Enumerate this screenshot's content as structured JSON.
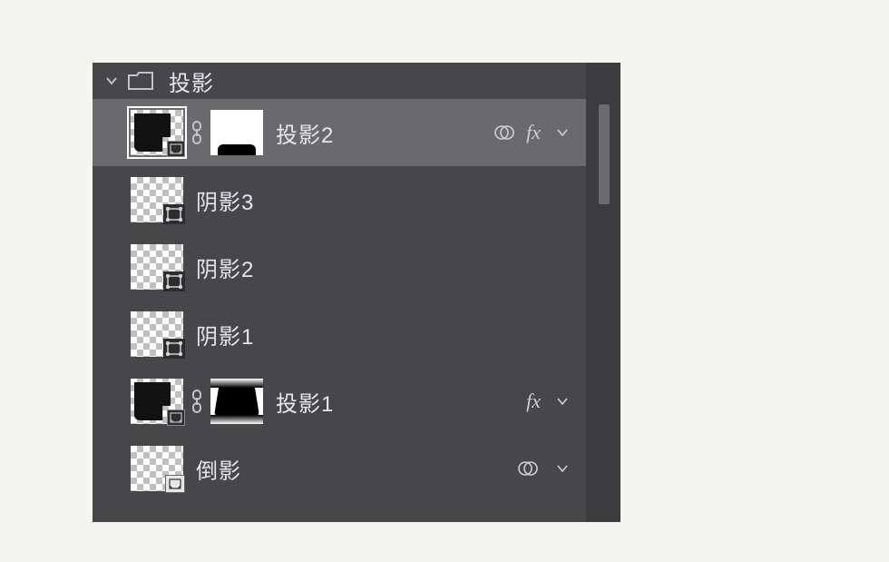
{
  "group": {
    "name": "投影",
    "expanded": true
  },
  "layers": [
    {
      "id": "proj2",
      "name": "投影2",
      "selected": true,
      "has_mask": true,
      "linked": true,
      "mask_kind": "white-blob",
      "thumb_kind": "black-c-checker",
      "smart": true,
      "blend_icon": true,
      "fx": true,
      "chevron": true
    },
    {
      "id": "shadow3",
      "name": "阴影3",
      "selected": false,
      "has_mask": false,
      "linked": false,
      "thumb_kind": "checker-shape",
      "smart": false
    },
    {
      "id": "shadow2",
      "name": "阴影2",
      "selected": false,
      "has_mask": false,
      "linked": false,
      "thumb_kind": "checker-shape",
      "smart": false
    },
    {
      "id": "shadow1",
      "name": "阴影1",
      "selected": false,
      "has_mask": false,
      "linked": false,
      "thumb_kind": "checker-shape",
      "smart": false
    },
    {
      "id": "proj1",
      "name": "投影1",
      "selected": false,
      "has_mask": true,
      "linked": true,
      "mask_kind": "black-round",
      "thumb_kind": "black-c-checker",
      "smart": true,
      "fx": true,
      "chevron": true
    },
    {
      "id": "reflect",
      "name": "倒影",
      "selected": false,
      "has_mask": false,
      "linked": false,
      "thumb_kind": "checker-smart",
      "smart": true,
      "blend_icon": true,
      "chevron": true
    }
  ]
}
